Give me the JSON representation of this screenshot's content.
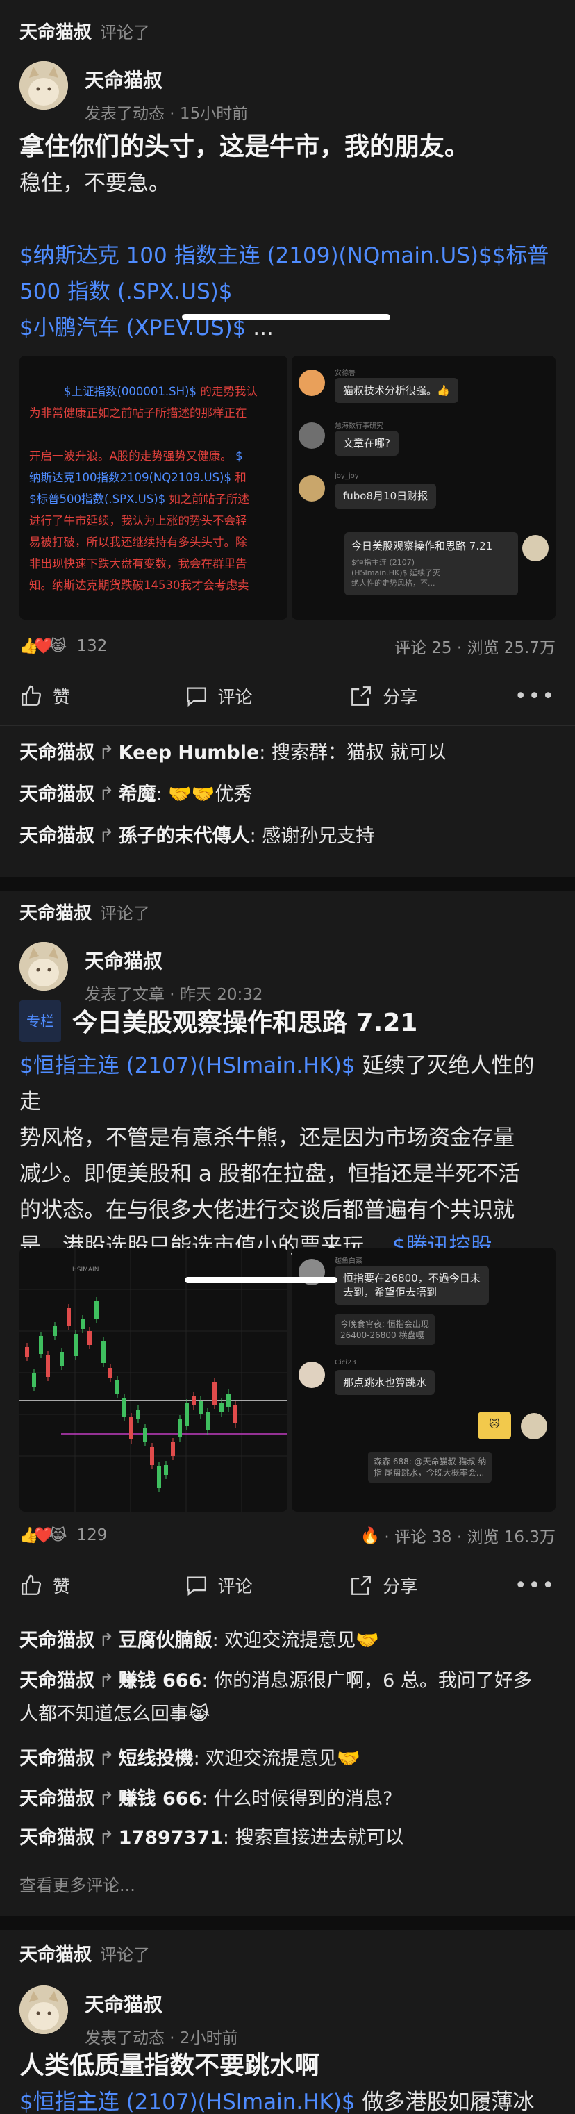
{
  "posts": [
    {
      "header_name": "天命猫叔",
      "header_verb": "评论了",
      "author": "天命猫叔",
      "meta": "发表了动态 · 15小时前",
      "title": "拿住你们的头寸，这是牛市，我的朋友。",
      "body_line1": "稳住，不要急。",
      "link1": "$纳斯达克 100 指数主连 (2109)(NQmain.US)$$标普",
      "link2": "500 指数 (.SPX.US)$",
      "link3": "$小鹏汽车 (XPEV.US)$",
      "link3_more": " ...",
      "image_text": {
        "l1a": "$上证指数(000001.SH)$",
        "l1b": " 的走势我认",
        "l2": "为非常健康正如之前帖子所描述的那样正在",
        "l3": "开启一波升浪。A股的走势强势又健康。",
        "l3b": " $",
        "l4a": "纳斯达克100指数2109(NQ2109.US)$",
        "l4b": " 和",
        "l5a": "$标普500指数(.SPX.US)$",
        "l5b": " 如之前帖子所述",
        "l6": "进行了牛市延续，我认为上涨的势头不会轻",
        "l7": "易被打破，所以我还继续持有多头头寸。除",
        "l8": "非出现快速下跌大盘有变数，我会在群里告",
        "l9": "知。纳斯达克期货跌破14530我才会考虑卖"
      },
      "chat": {
        "n1": "安德鲁",
        "m1": "猫叔技术分析很强。👍",
        "n2": "慧海数行事研究",
        "m2": "文章在哪?",
        "n3": "joy_joy",
        "m3": "fubo8月10日财报",
        "m4": "今日美股观察操作和思路 7.21",
        "q4": "$恒指主连 (2107)\n(HSImain.HK)$ 延续了灭\n绝人性的走势风格，不..."
      },
      "reaction_count": "132",
      "reactions": "👍❤️😹",
      "stats": "评论 25 · 浏览 25.7万",
      "actions": {
        "like": "赞",
        "comment": "评论",
        "share": "分享"
      },
      "comments": [
        {
          "from": "天命猫叔",
          "to": "Keep Humble",
          "text": ": 搜索群：猫叔 就可以"
        },
        {
          "from": "天命猫叔",
          "to": "希魔",
          "text": ": 🤝🤝优秀"
        },
        {
          "from": "天命猫叔",
          "to": "孫子的末代傳人",
          "text": ": 感谢孙兄支持"
        }
      ]
    },
    {
      "header_name": "天命猫叔",
      "header_verb": "评论了",
      "author": "天命猫叔",
      "meta": "发表了文章 · 昨天 20:32",
      "badge": "专栏",
      "title": "今日美股观察操作和思路 7.21",
      "body_link1": "$恒指主连 (2107)(HSImain.HK)$",
      "body_text1": " 延续了灭绝人性的走",
      "body_text2": "势风格，不管是有意杀牛熊，还是因为市场资金存量",
      "body_text3": "减少。即便美股和 a 股都在拉盘，恒指还是半死不活",
      "body_text4": "的状态。在与很多大佬进行交谈后都普遍有个共识就",
      "body_text5": "是，港股选股只能选市值小的票来玩。",
      "body_link2": " $腾讯控股...",
      "chat": {
        "n1": "越鱼白菜",
        "m1": "恒指要在26800，不過今日未\n去到，希望佢去唔到",
        "q1": "今晚食宵夜: 恒指会出现\n26400-26800 横盘嘎",
        "n2": "Cici23",
        "m2": "那点跳水也算跳水",
        "q3": "森森 688: @天命猫叔 猫叔 纳\n指 尾盘跳水，今晚大概率会..."
      },
      "chart_tag": "HSIMAIN",
      "reaction_count": "129",
      "reactions": "👍❤️😹",
      "stats": "· 评论 38 · 浏览 16.3万",
      "actions": {
        "like": "赞",
        "comment": "评论",
        "share": "分享"
      },
      "comments": [
        {
          "from": "天命猫叔",
          "to": "豆腐伙腩飯",
          "text": ": 欢迎交流提意见🤝"
        },
        {
          "from": "天命猫叔",
          "to": "赚钱 666",
          "text": ": 你的消息源很广啊，6 总。我问了好多"
        },
        {
          "cont": "人都不知道怎么回事😹"
        },
        {
          "from": "天命猫叔",
          "to": "短线投機",
          "text": ": 欢迎交流提意见🤝"
        },
        {
          "from": "天命猫叔",
          "to": "赚钱 666",
          "text": ": 什么时候得到的消息?"
        },
        {
          "from": "天命猫叔",
          "to": "17897371",
          "text": ": 搜索直接进去就可以"
        }
      ],
      "see_more": "查看更多评论..."
    },
    {
      "header_name": "天命猫叔",
      "header_verb": "评论了",
      "author": "天命猫叔",
      "meta": "发表了动态 · 2小时前",
      "title": "人类低质量指数不要跳水啊",
      "body_link": "$恒指主连 (2107)(HSImain.HK)$",
      "body_text": " 做多港股如履薄冰"
    }
  ],
  "colors": {
    "link": "#4f8cff",
    "bg": "#1a1a1a",
    "red_text": "#e0403c",
    "blue_text": "#4f8cff"
  }
}
